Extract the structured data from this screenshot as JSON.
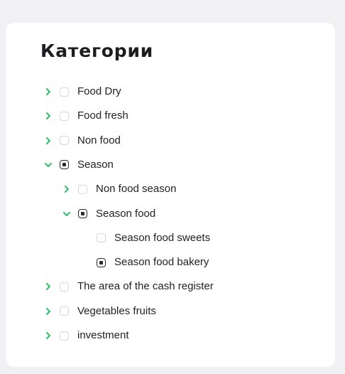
{
  "panel": {
    "title": "Категории"
  },
  "colors": {
    "chevron": "#2fbf63",
    "checkbox_border": "#d6d6dc",
    "checkbox_checked": "#2b2b2f"
  },
  "tree": [
    {
      "label": "Food Dry",
      "level": 0,
      "expander": "collapsed",
      "checked": false
    },
    {
      "label": "Food fresh",
      "level": 0,
      "expander": "collapsed",
      "checked": false
    },
    {
      "label": "Non food",
      "level": 0,
      "expander": "collapsed",
      "checked": false
    },
    {
      "label": "Season",
      "level": 0,
      "expander": "expanded",
      "checked": true
    },
    {
      "label": "Non food season",
      "level": 1,
      "expander": "collapsed",
      "checked": false
    },
    {
      "label": "Season food",
      "level": 1,
      "expander": "expanded",
      "checked": true
    },
    {
      "label": "Season food sweets",
      "level": 2,
      "expander": "none",
      "checked": false
    },
    {
      "label": "Season food bakery",
      "level": 2,
      "expander": "none",
      "checked": true
    },
    {
      "label": "The area of the cash register",
      "level": 0,
      "expander": "collapsed",
      "checked": false
    },
    {
      "label": "Vegetables fruits",
      "level": 0,
      "expander": "collapsed",
      "checked": false
    },
    {
      "label": "investment",
      "level": 0,
      "expander": "collapsed",
      "checked": false
    }
  ]
}
